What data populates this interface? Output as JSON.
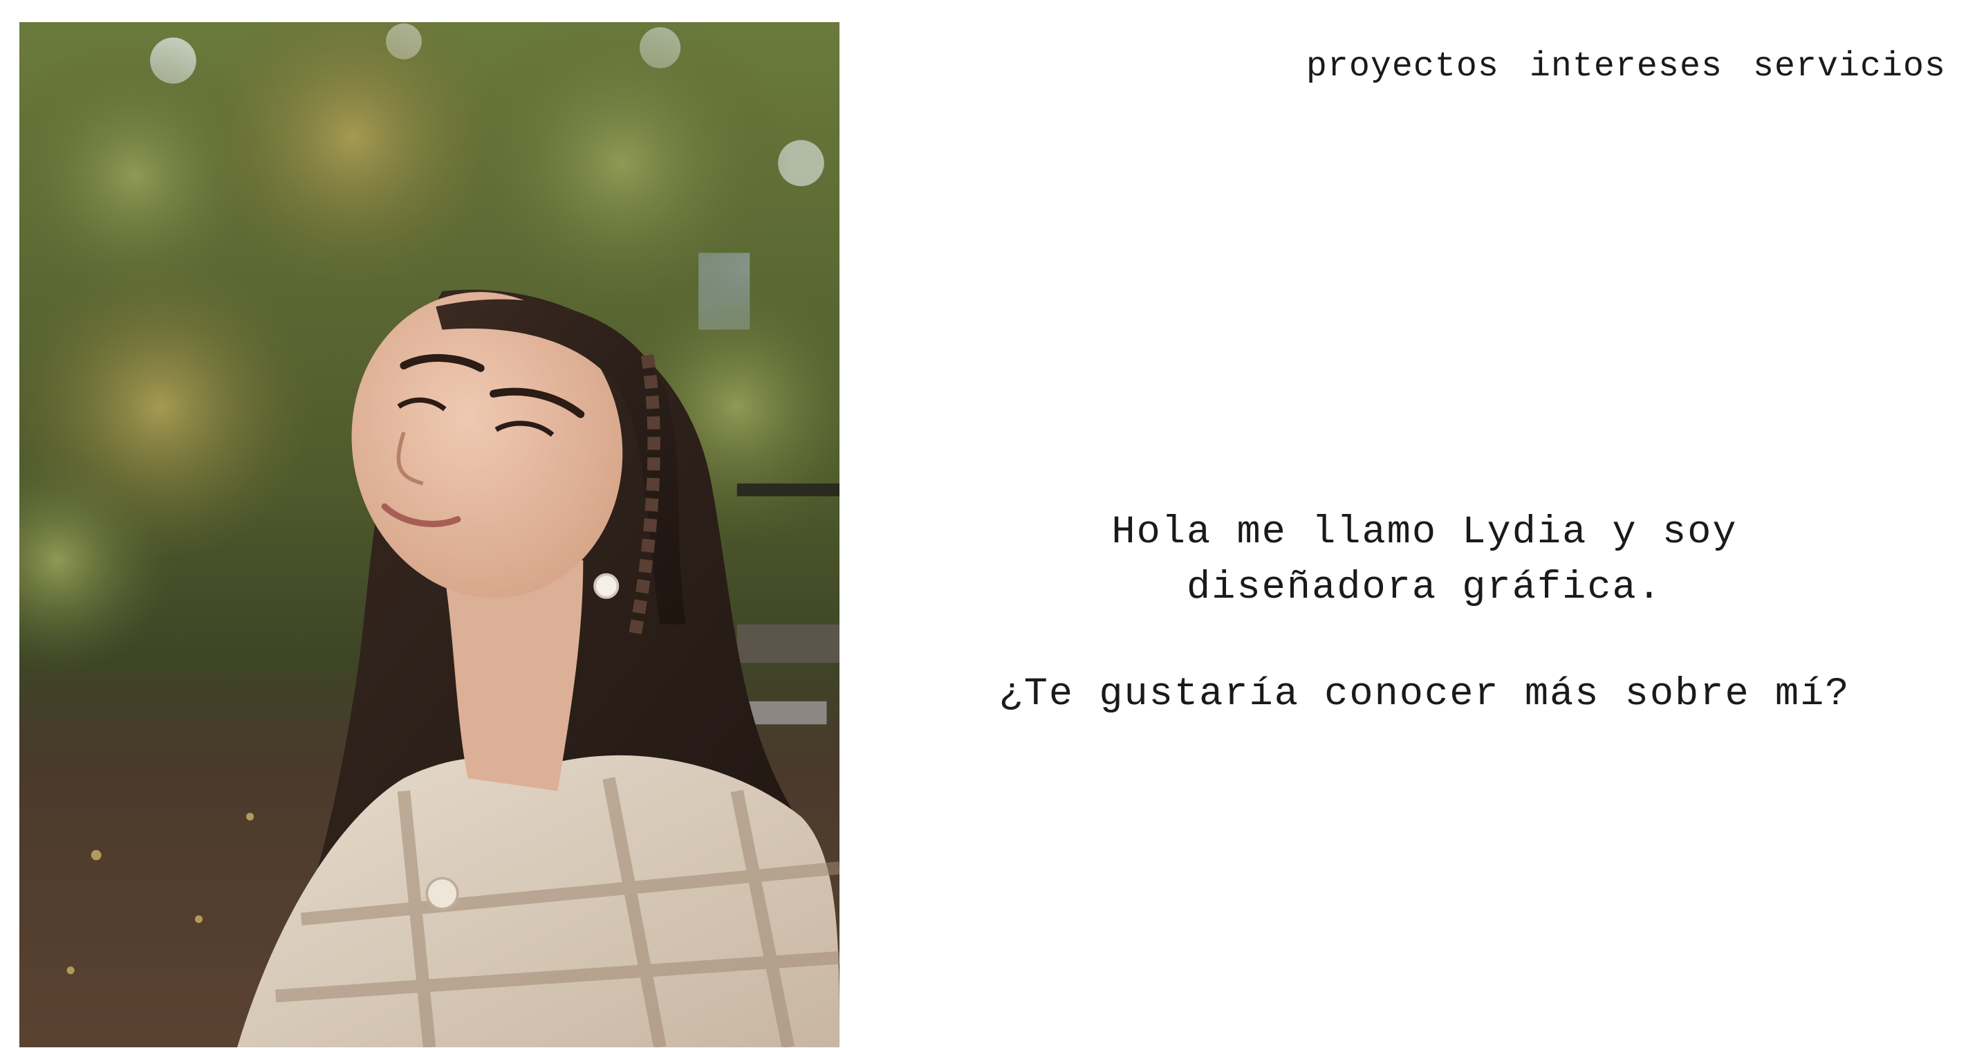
{
  "nav": {
    "items": [
      {
        "label": "proyectos"
      },
      {
        "label": "intereses"
      },
      {
        "label": "servicios"
      }
    ]
  },
  "intro": {
    "line1": "Hola me llamo Lydia y soy",
    "line2": "diseñadora gráfica.",
    "question": "¿Te gustaría conocer más sobre mí?"
  },
  "photo": {
    "subject": "portrait-photo"
  },
  "colors": {
    "background": "#ffffff",
    "text": "#1a1a1a",
    "foliage": "#5f6b35",
    "hair": "#2b1e18",
    "jacket": "#d9cbbb"
  }
}
